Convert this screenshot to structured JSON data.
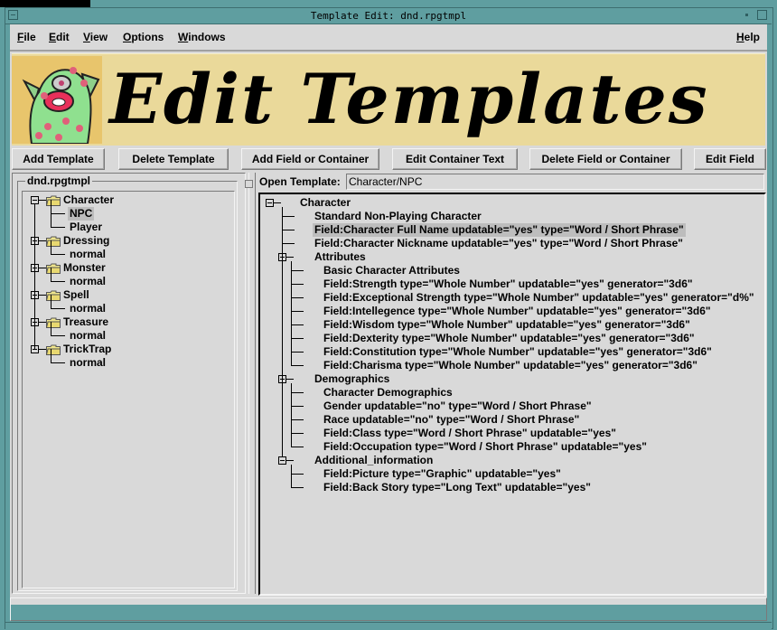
{
  "window": {
    "title": "Template Edit: dnd.rpgtmpl"
  },
  "menubar": {
    "items": [
      {
        "label": "File",
        "mnemonic": "F",
        "rest": "ile"
      },
      {
        "label": "Edit",
        "mnemonic": "E",
        "rest": "dit"
      },
      {
        "label": "View",
        "mnemonic": "V",
        "rest": "iew"
      },
      {
        "label": "Options",
        "mnemonic": "O",
        "rest": "ptions"
      },
      {
        "label": "Windows",
        "mnemonic": "W",
        "rest": "indows"
      }
    ],
    "help": {
      "label": "Help",
      "mnemonic": "H",
      "rest": "elp"
    }
  },
  "banner": {
    "title": "Edit Templates",
    "image_desc": "green-spotted-monster"
  },
  "toolbar": {
    "buttons": [
      "Add Template",
      "Delete Template",
      "Add Field or Container",
      "Edit Container Text",
      "Delete Field or Container",
      "Edit Field"
    ]
  },
  "left_panel": {
    "group_label": "dnd.rpgtmpl",
    "tree": [
      {
        "label": "Character",
        "children": [
          "NPC",
          "Player"
        ],
        "selected_child": "NPC"
      },
      {
        "label": "Dressing",
        "children": [
          "normal"
        ]
      },
      {
        "label": "Monster",
        "children": [
          "normal"
        ]
      },
      {
        "label": "Spell",
        "children": [
          "normal"
        ]
      },
      {
        "label": "Treasure",
        "children": [
          "normal"
        ]
      },
      {
        "label": "TrickTrap",
        "children": [
          "normal"
        ]
      }
    ]
  },
  "open_template": {
    "label": "Open Template:",
    "value": "Character/NPC"
  },
  "template_tree": {
    "root": "Character",
    "rows": [
      {
        "level": 1,
        "text": "Standard Non-Playing Character"
      },
      {
        "level": 1,
        "text": "Field:Character Full Name updatable=\"yes\" type=\"Word / Short Phrase\"",
        "selected": true
      },
      {
        "level": 1,
        "text": "Field:Character Nickname updatable=\"yes\" type=\"Word / Short Phrase\""
      },
      {
        "level": 1,
        "text": "Attributes",
        "container": true
      },
      {
        "level": 2,
        "text": "Basic Character Attributes"
      },
      {
        "level": 2,
        "text": "Field:Strength type=\"Whole Number\" updatable=\"yes\" generator=\"3d6\""
      },
      {
        "level": 2,
        "text": "Field:Exceptional Strength type=\"Whole Number\" updatable=\"yes\" generator=\"d%\""
      },
      {
        "level": 2,
        "text": "Field:Intellegence type=\"Whole Number\" updatable=\"yes\" generator=\"3d6\""
      },
      {
        "level": 2,
        "text": "Field:Wisdom type=\"Whole Number\" updatable=\"yes\" generator=\"3d6\""
      },
      {
        "level": 2,
        "text": "Field:Dexterity type=\"Whole Number\" updatable=\"yes\" generator=\"3d6\""
      },
      {
        "level": 2,
        "text": "Field:Constitution type=\"Whole Number\" updatable=\"yes\" generator=\"3d6\""
      },
      {
        "level": 2,
        "text": "Field:Charisma type=\"Whole Number\" updatable=\"yes\" generator=\"3d6\""
      },
      {
        "level": 1,
        "text": "Demographics",
        "container": true
      },
      {
        "level": 2,
        "text": "Character Demographics"
      },
      {
        "level": 2,
        "text": "Gender updatable=\"no\" type=\"Word / Short Phrase\""
      },
      {
        "level": 2,
        "text": "Race updatable=\"no\" type=\"Word / Short Phrase\""
      },
      {
        "level": 2,
        "text": "Field:Class type=\"Word / Short Phrase\" updatable=\"yes\""
      },
      {
        "level": 2,
        "text": "Field:Occupation type=\"Word / Short Phrase\" updatable=\"yes\""
      },
      {
        "level": 1,
        "text": "Additional_information",
        "container": true
      },
      {
        "level": 2,
        "text": "Field:Picture type=\"Graphic\" updatable=\"yes\""
      },
      {
        "level": 2,
        "text": "Field:Back Story type=\"Long Text\" updatable=\"yes\""
      }
    ]
  },
  "status": {
    "text": ""
  },
  "colors": {
    "desktop": "#5f9ea0",
    "window_bg": "#d9d9d9",
    "banner_bg": "#ead99a",
    "selection": "#bdbdbd"
  }
}
